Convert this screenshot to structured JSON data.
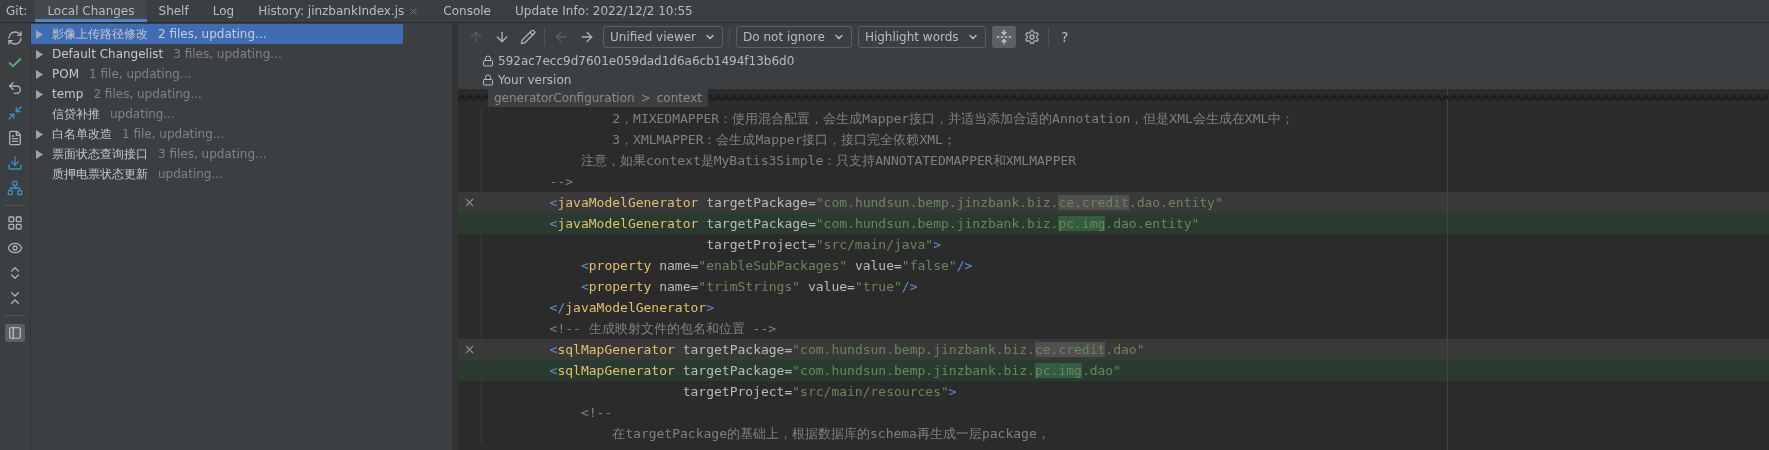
{
  "tool_window": {
    "label": "Git:",
    "tabs": [
      {
        "label": "Local Changes",
        "selected": true,
        "closable": false
      },
      {
        "label": "Shelf",
        "selected": false,
        "closable": false
      },
      {
        "label": "Log",
        "selected": false,
        "closable": false
      },
      {
        "label": "History: jinzbankIndex.js",
        "selected": false,
        "closable": true
      },
      {
        "label": "Console",
        "selected": false,
        "closable": false
      },
      {
        "label": "Update Info: 2022/12/2 10:55",
        "selected": false,
        "closable": false
      }
    ]
  },
  "side_toolbar": {
    "preview_on": true
  },
  "changelists": [
    {
      "name": "影像上传路径修改",
      "detail": "2 files, updating...",
      "expandable": true,
      "selected": true
    },
    {
      "name": "Default Changelist",
      "detail": "3 files, updating...",
      "expandable": true,
      "selected": false
    },
    {
      "name": "POM",
      "detail": "1 file, updating...",
      "expandable": true,
      "selected": false
    },
    {
      "name": "temp",
      "detail": "2 files, updating...",
      "expandable": true,
      "selected": false
    },
    {
      "name": "信贷补推",
      "detail": "updating...",
      "expandable": false,
      "selected": false
    },
    {
      "name": "白名单改造",
      "detail": "1 file, updating...",
      "expandable": true,
      "selected": false
    },
    {
      "name": "票面状态查询接口",
      "detail": "3 files, updating...",
      "expandable": true,
      "selected": false
    },
    {
      "name": "质押电票状态更新",
      "detail": "updating...",
      "expandable": false,
      "selected": false
    }
  ],
  "diff": {
    "nav": [
      {
        "kind": "up",
        "disabled": true
      },
      {
        "kind": "down",
        "disabled": false
      },
      {
        "kind": "edit",
        "disabled": false
      },
      {
        "kind": "left",
        "disabled": true
      },
      {
        "kind": "right",
        "disabled": false
      }
    ],
    "dropdowns": [
      "Unified viewer",
      "Do not ignore",
      "Highlight words"
    ],
    "collapse_on": true,
    "help": "?",
    "versions": [
      "592ac7ecc9d7601e059dad1d6a6cb1494f13b6d0",
      "Your version"
    ],
    "breadcrumb": {
      "items": [
        "generatorConfiguration",
        "context"
      ],
      "separator": ">"
    },
    "lines": [
      {
        "kind": "context",
        "tokens": [
          {
            "kind": "comment",
            "text": "                2，MIXEDMAPPER：使用混合配置，会生成Mapper接口，并适当添加合适的Annotation，但是XML会生成在XML中；"
          }
        ]
      },
      {
        "kind": "context",
        "tokens": [
          {
            "kind": "comment",
            "text": "                3，XMLMAPPER：会生成Mapper接口，接口完全依赖XML；"
          }
        ]
      },
      {
        "kind": "context",
        "tokens": [
          {
            "kind": "comment",
            "text": "            注意，如果context是MyBatis3Simple：只支持ANNOTATEDMAPPER和XMLMAPPER"
          }
        ]
      },
      {
        "kind": "context",
        "tokens": [
          {
            "kind": "comment",
            "text": "        -->"
          }
        ]
      },
      {
        "kind": "removed",
        "tokens": [
          {
            "kind": "bracket",
            "text": "        <"
          },
          {
            "kind": "tag",
            "text": "javaModelGenerator"
          },
          {
            "kind": "attr",
            "text": " targetPackage="
          },
          {
            "kind": "string",
            "text": "\"com.hundsun.bemp.jinzbank.biz."
          },
          {
            "kind": "diff-string",
            "text": "ce.credit"
          },
          {
            "kind": "string",
            "text": ".dao.entity\""
          }
        ]
      },
      {
        "kind": "added",
        "tokens": [
          {
            "kind": "bracket",
            "text": "        <"
          },
          {
            "kind": "tag",
            "text": "javaModelGenerator"
          },
          {
            "kind": "attr",
            "text": " targetPackage="
          },
          {
            "kind": "string",
            "text": "\"com.hundsun.bemp.jinzbank.biz."
          },
          {
            "kind": "diff-string",
            "text": "pc.img"
          },
          {
            "kind": "string",
            "text": ".dao.entity\""
          }
        ]
      },
      {
        "kind": "context",
        "tokens": [
          {
            "kind": "attr",
            "text": "                            targetProject="
          },
          {
            "kind": "string",
            "text": "\"src/main/java\""
          },
          {
            "kind": "bracket",
            "text": ">"
          }
        ]
      },
      {
        "kind": "context",
        "tokens": [
          {
            "kind": "bracket",
            "text": "            <"
          },
          {
            "kind": "tag",
            "text": "property"
          },
          {
            "kind": "attr",
            "text": " name="
          },
          {
            "kind": "string",
            "text": "\"enableSubPackages\""
          },
          {
            "kind": "attr",
            "text": " value="
          },
          {
            "kind": "string",
            "text": "\"false\""
          },
          {
            "kind": "bracket",
            "text": "/>"
          }
        ]
      },
      {
        "kind": "context",
        "tokens": [
          {
            "kind": "bracket",
            "text": "            <"
          },
          {
            "kind": "tag",
            "text": "property"
          },
          {
            "kind": "attr",
            "text": " name="
          },
          {
            "kind": "string",
            "text": "\"trimStrings\""
          },
          {
            "kind": "attr",
            "text": " value="
          },
          {
            "kind": "string",
            "text": "\"true\""
          },
          {
            "kind": "bracket",
            "text": "/>"
          }
        ]
      },
      {
        "kind": "context",
        "tokens": [
          {
            "kind": "bracket",
            "text": "        </"
          },
          {
            "kind": "tag",
            "text": "javaModelGenerator"
          },
          {
            "kind": "bracket",
            "text": ">"
          }
        ]
      },
      {
        "kind": "context",
        "tokens": [
          {
            "kind": "comment",
            "text": "        <!-- 生成映射文件的包名和位置 -->"
          }
        ]
      },
      {
        "kind": "removed",
        "tokens": [
          {
            "kind": "bracket",
            "text": "        <"
          },
          {
            "kind": "tag",
            "text": "sqlMapGenerator"
          },
          {
            "kind": "attr",
            "text": " targetPackage="
          },
          {
            "kind": "string",
            "text": "\"com.hundsun.bemp.jinzbank.biz."
          },
          {
            "kind": "diff-string",
            "text": "ce.credit"
          },
          {
            "kind": "string",
            "text": ".dao\""
          }
        ]
      },
      {
        "kind": "added",
        "tokens": [
          {
            "kind": "bracket",
            "text": "        <"
          },
          {
            "kind": "tag",
            "text": "sqlMapGenerator"
          },
          {
            "kind": "attr",
            "text": " targetPackage="
          },
          {
            "kind": "string",
            "text": "\"com.hundsun.bemp.jinzbank.biz."
          },
          {
            "kind": "diff-string",
            "text": "pc.img"
          },
          {
            "kind": "string",
            "text": ".dao\""
          }
        ]
      },
      {
        "kind": "context",
        "tokens": [
          {
            "kind": "attr",
            "text": "                         targetProject="
          },
          {
            "kind": "string",
            "text": "\"src/main/resources\""
          },
          {
            "kind": "bracket",
            "text": ">"
          }
        ]
      },
      {
        "kind": "context",
        "tokens": [
          {
            "kind": "comment",
            "text": "            <!--"
          }
        ]
      },
      {
        "kind": "context",
        "tokens": [
          {
            "kind": "comment",
            "text": "                在targetPackage的基础上，根据数据库的schema再生成一层package，"
          }
        ]
      }
    ]
  }
}
